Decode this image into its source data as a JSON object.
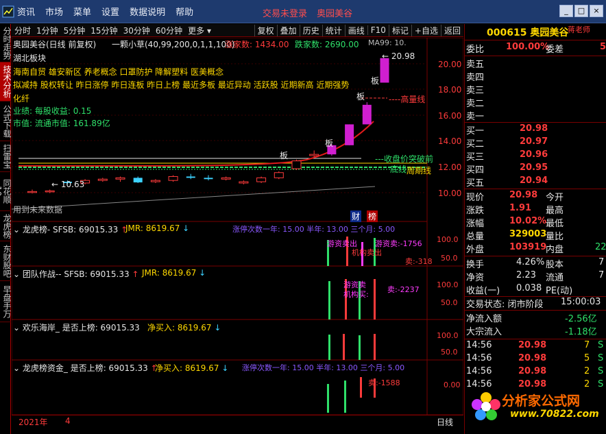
{
  "menu": {
    "items": [
      "资讯",
      "市场",
      "菜单",
      "设置",
      "数据说明",
      "帮助"
    ],
    "status": [
      "交易未登录",
      "奥园美谷"
    ]
  },
  "window_controls": [
    "_",
    "□",
    "×"
  ],
  "left_tabs": [
    {
      "label": "分时走势",
      "active": false
    },
    {
      "label": "技术分析",
      "active": true
    },
    {
      "label": "公式下载",
      "active": false
    },
    {
      "label": "扫雷宝",
      "active": false
    },
    {
      "label": "同花顺10",
      "active": false
    },
    {
      "label": "龙虎榜",
      "active": false
    },
    {
      "label": "东财股吧",
      "active": false
    },
    {
      "label": "早盘手万",
      "active": false
    }
  ],
  "toolbar": {
    "periods": [
      "分时",
      "1分钟",
      "5分钟",
      "15分钟",
      "30分钟",
      "60分钟",
      "更多"
    ],
    "buttons": [
      "复权",
      "叠加",
      "历史",
      "统计",
      "画线",
      "F10",
      "标记",
      "+自选",
      "返回"
    ]
  },
  "chart": {
    "header": {
      "title": "奥园美谷(日线 前复权)",
      "indicator": "一颗小草(40,99,200,0,1,1,100)",
      "rise_label": "涨家数: 1434.00",
      "fall_label": "跌家数: 2690.00",
      "ma_label": "MA99: 10."
    },
    "info_lines": [
      {
        "text": "湖北板块",
        "color": "#e6e6e6"
      },
      {
        "text": "海南自贸 雄安新区 养老概念 口罩防护 降解塑料 医美概念",
        "color": "#ffd800"
      },
      {
        "text": "拟减持 股权转让 昨日涨停 昨日连板 昨日上榜 最近多板 最近异动 活跃股 近期新高 近期强势",
        "color": "#ffd800"
      },
      {
        "text": "化纤",
        "color": "#ffd800"
      },
      {
        "text": "业绩: 每股收益: 0.15",
        "color": "#2fe06a"
      },
      {
        "text": "市值: 流通市值: 161.89亿",
        "color": "#2fe06a"
      }
    ],
    "annotations": {
      "high": "20.98",
      "low": "10.63",
      "high_line": "高量线",
      "close_break": "收盘价突破前",
      "lowline": "底线",
      "period_line": "周期线",
      "future_data": "用到未来数据",
      "cai": "财",
      "bang": "榜",
      "ban": "板"
    },
    "y_axis": [
      "20.00",
      "18.00",
      "16.00",
      "14.00",
      "12.00",
      "10.00"
    ],
    "panels": [
      {
        "title": "龙虎榜- SFSB: 69015.33",
        "jmr": "JMR: 8619.67",
        "extra": "涨停次数一年: 15.00  半年: 13.00  三个月: 5.00",
        "axis": [
          "100.0",
          "50.0"
        ]
      },
      {
        "title": "团队作战-- SFSB: 69015.33",
        "jmr": "JMR: 8619.67",
        "extra": "",
        "axis": [
          "100.0",
          "50.0"
        ]
      },
      {
        "title": "欢乐海岸_ 是否上榜: 69015.33",
        "jmr": "净买入: 8619.67",
        "extra": "",
        "axis": [
          "100.0",
          "50.0"
        ]
      },
      {
        "title": "龙虎榜资金_ 是否上榜: 69015.33",
        "jmr": "净买入: 8619.67",
        "extra": "涨停次数一年: 15.00  半年: 13.00  三个月: 5.00",
        "axis": [
          "0.00"
        ]
      }
    ],
    "panel_labels": {
      "p1_a": "游资卖出",
      "p1_b": "机构卖出",
      "p1_c": "卖:-318",
      "p1_d": "游资卖:-1756",
      "p2_a": "游资卖",
      "p2_b": "机构买:",
      "p2_c": "卖:-2237",
      "p4_a": "卖:-1588"
    }
  },
  "chart_data": {
    "type": "candlestick",
    "categories": [
      "1",
      "2",
      "3",
      "4",
      "5",
      "6",
      "7",
      "8",
      "9",
      "10",
      "11",
      "12",
      "13",
      "14",
      "15",
      "16",
      "17",
      "18",
      "19",
      "20",
      "21"
    ],
    "ohlc": [
      [
        10.7,
        10.9,
        10.6,
        10.75
      ],
      [
        10.75,
        10.9,
        10.63,
        10.8
      ],
      [
        11.5,
        11.6,
        11.3,
        11.4
      ],
      [
        11.4,
        11.7,
        11.3,
        11.6
      ],
      [
        11.6,
        11.8,
        11.5,
        11.7
      ],
      [
        11.7,
        11.9,
        11.5,
        11.8
      ],
      [
        11.8,
        11.9,
        11.4,
        11.45
      ],
      [
        11.5,
        11.7,
        11.4,
        11.6
      ],
      [
        11.6,
        12.0,
        11.5,
        11.9
      ],
      [
        11.9,
        12.1,
        11.7,
        11.8
      ],
      [
        11.8,
        12.0,
        11.6,
        11.7
      ],
      [
        11.7,
        11.9,
        11.6,
        11.8
      ],
      [
        11.4,
        11.6,
        11.3,
        11.5
      ],
      [
        11.5,
        11.9,
        11.4,
        11.8
      ],
      [
        11.8,
        12.3,
        11.7,
        12.2
      ],
      [
        12.5,
        13.2,
        12.4,
        13.1
      ],
      [
        13.5,
        13.9,
        13.4,
        13.6
      ],
      [
        13.6,
        14.4,
        13.5,
        14.3
      ],
      [
        14.3,
        15.9,
        14.3,
        15.9
      ],
      [
        15.9,
        17.6,
        15.9,
        17.4
      ],
      [
        19.1,
        20.98,
        19.1,
        20.98
      ]
    ],
    "ylim": [
      9.4,
      21.6
    ],
    "y_ticks": [
      10,
      12,
      14,
      16,
      18,
      20
    ]
  },
  "bottom": {
    "year": "2021年",
    "num": "4",
    "period": "日线"
  },
  "right_panel": {
    "title": "000615 奥园美谷",
    "user": "蒋老师",
    "weibi": [
      "委比",
      "100.00%",
      "委差",
      "5"
    ],
    "sells": [
      [
        "卖五",
        ""
      ],
      [
        "卖四",
        ""
      ],
      [
        "卖三",
        ""
      ],
      [
        "卖二",
        ""
      ],
      [
        "卖一",
        ""
      ]
    ],
    "buys": [
      [
        "买一",
        "20.98"
      ],
      [
        "买二",
        "20.97"
      ],
      [
        "买三",
        "20.96"
      ],
      [
        "买四",
        "20.95"
      ],
      [
        "买五",
        "20.94"
      ]
    ],
    "quote": [
      [
        "现价",
        "20.98",
        "今开",
        ""
      ],
      [
        "涨跌",
        "1.91",
        "最高",
        ""
      ],
      [
        "涨幅",
        "10.02%",
        "最低",
        ""
      ],
      [
        "总量",
        "329003",
        "量比",
        ""
      ],
      [
        "外盘",
        "103919",
        "内盘",
        "22"
      ]
    ],
    "stats": [
      [
        "换手",
        "4.26%",
        "股本",
        "7"
      ],
      [
        "净资",
        "2.23",
        "流通",
        "7"
      ],
      [
        "收益(一)",
        "0.038",
        "PE(动)",
        ""
      ]
    ],
    "trade_state": "交易状态: 闭市阶段",
    "trade_time": "15:00:03",
    "net_inflow": [
      "净流入额",
      "-2.56亿"
    ],
    "block_inflow": [
      "大宗流入",
      "-1.18亿"
    ],
    "ticks": [
      [
        "14:56",
        "20.98",
        "7",
        "S"
      ],
      [
        "14:56",
        "20.98",
        "5",
        "S"
      ],
      [
        "14:56",
        "20.98",
        "2",
        "S"
      ],
      [
        "14:56",
        "20.98",
        "2",
        "S"
      ]
    ]
  },
  "watermark": {
    "brand": "分析家公式网",
    "url": "www.70822.com"
  }
}
